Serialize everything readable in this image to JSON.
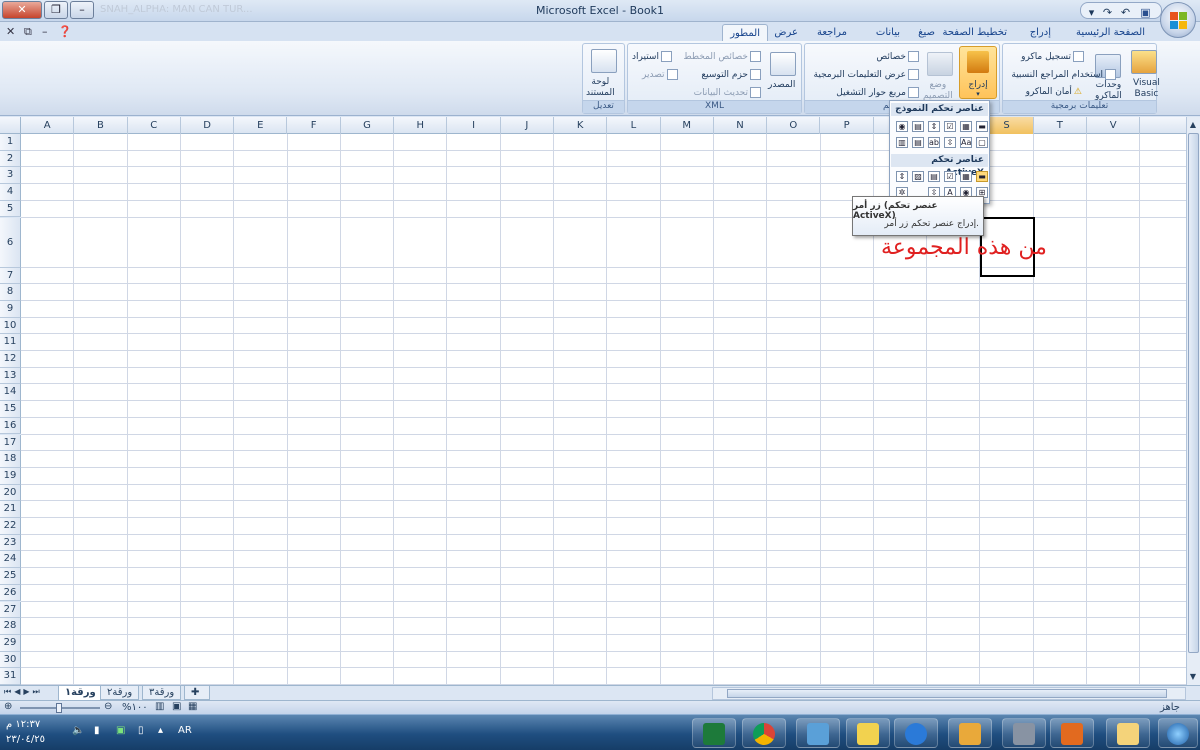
{
  "window": {
    "title": "Microsoft Excel - Book1",
    "faded_caption": "SNAH_ALPHA: MAN CAN TUR..."
  },
  "tabs": [
    {
      "label": "الصفحة الرئيسية",
      "active": false
    },
    {
      "label": "إدراج",
      "active": false
    },
    {
      "label": "تخطيط الصفحة",
      "active": false
    },
    {
      "label": "صيغ",
      "active": false
    },
    {
      "label": "بيانات",
      "active": false
    },
    {
      "label": "مراجعة",
      "active": false
    },
    {
      "label": "عرض",
      "active": false
    },
    {
      "label": "المطور",
      "active": true
    }
  ],
  "ribbon": {
    "code_group": {
      "label": "تعليمات برمجية",
      "visual_basic_line1": "Visual",
      "visual_basic_line2": "Basic",
      "macros_line1": "وحدات",
      "macros_line2": "الماكرو",
      "record_macro": "تسجيل ماكرو",
      "relative_refs": "استخدام المراجع النسبية",
      "macro_security": "أمان الماكرو"
    },
    "controls_group": {
      "label": "عناصر تحكم",
      "insert": "إدراج",
      "design_mode_line1": "وضع",
      "design_mode_line2": "التصميم",
      "properties": "خصائص",
      "view_code": "عرض التعليمات البرمجية",
      "run_dialog": "مربع حوار التشغيل"
    },
    "xml_group": {
      "label": "XML",
      "source": "المصدر",
      "map_properties": "خصائص المخطط",
      "expansion_packs": "حزم التوسيع",
      "refresh_data": "تحديث البيانات",
      "import": "استيراد",
      "export": "تصدير"
    },
    "modify_group": {
      "label": "تعديل",
      "document_panel_line1": "لوحة",
      "document_panel_line2": "المستند"
    }
  },
  "dropdown": {
    "form_controls_header": "عناصر تحكم النموذج",
    "activex_header": "عناصر تحكم ActiveX"
  },
  "tooltip": {
    "title": "زر أمر (عنصر تحكم ActiveX)",
    "description": "إدراج عنصر تحكم زر أمر."
  },
  "columns": [
    "A",
    "B",
    "C",
    "D",
    "E",
    "F",
    "G",
    "H",
    "I",
    "J",
    "K",
    "L",
    "M",
    "N",
    "O",
    "P",
    "Q",
    "R",
    "S",
    "T",
    "V"
  ],
  "selected_column": "S",
  "rows": [
    "1",
    "2",
    "3",
    "4",
    "5",
    "6",
    "7",
    "8",
    "9",
    "10",
    "11",
    "12",
    "13",
    "14",
    "15",
    "16",
    "17",
    "18",
    "19",
    "20",
    "21",
    "22",
    "23",
    "24",
    "25",
    "26",
    "27",
    "28",
    "29",
    "30",
    "31"
  ],
  "annotation": "من هذه المجموعة",
  "sheets": [
    {
      "label": "ورقة١",
      "active": true
    },
    {
      "label": "ورقة٢",
      "active": false
    },
    {
      "label": "ورقة٣",
      "active": false
    }
  ],
  "status": {
    "ready": "جاهز",
    "zoom": "%١٠٠"
  },
  "taskbar": {
    "lang": "AR",
    "time": "١٢:٣٧ م",
    "date": "٢٣/٠٤/٢٥"
  },
  "colors": {
    "accent": "#f1c15f",
    "annotation": "#e02020",
    "taskbar": "#1f4e80"
  }
}
